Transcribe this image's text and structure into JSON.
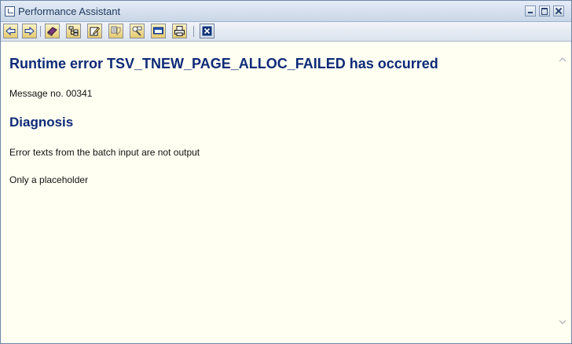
{
  "window": {
    "title": "Performance Assistant"
  },
  "toolbar": {
    "buttons": [
      {
        "name": "back",
        "icon": "arrow-left-icon"
      },
      {
        "name": "forward",
        "icon": "arrow-right-icon"
      },
      {
        "name": "glossary",
        "icon": "book-icon"
      },
      {
        "name": "structure",
        "icon": "hierarchy-icon"
      },
      {
        "name": "edit",
        "icon": "pencil-icon"
      },
      {
        "name": "technical-info",
        "icon": "notes-icon"
      },
      {
        "name": "settings",
        "icon": "tools-icon"
      },
      {
        "name": "display-format",
        "icon": "window-icon"
      },
      {
        "name": "print",
        "icon": "printer-icon"
      },
      {
        "name": "exit",
        "icon": "exit-icon"
      }
    ]
  },
  "document": {
    "heading": "Runtime error TSV_TNEW_PAGE_ALLOC_FAILED has occurred",
    "message_no": "Message no. 00341",
    "diagnosis_heading": "Diagnosis",
    "diagnosis_text": "Error texts from the batch input are not output",
    "placeholder_text": "Only a placeholder"
  },
  "colors": {
    "heading": "#0e2a78",
    "background": "#fffff2",
    "titlebar": "#c9d6e6"
  }
}
